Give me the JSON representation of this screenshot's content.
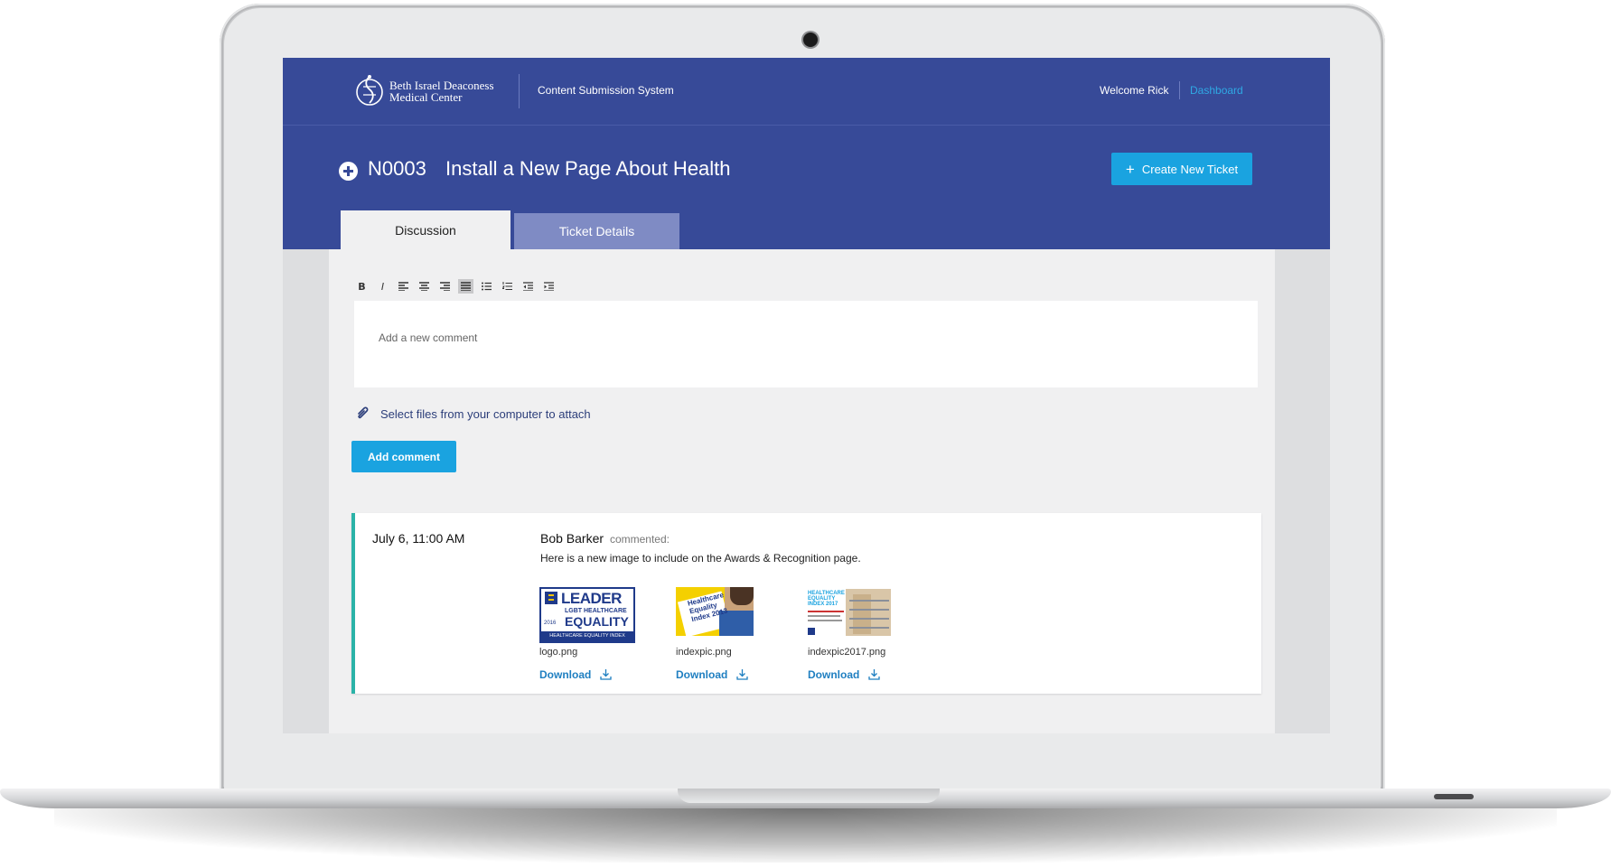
{
  "brand": {
    "org_line1": "Beth Israel Deaconess",
    "org_line2": "Medical Center",
    "system_name": "Content Submission System"
  },
  "nav": {
    "welcome": "Welcome Rick",
    "dashboard": "Dashboard"
  },
  "ticket": {
    "id": "N0003",
    "title": "Install a New Page About Health",
    "create_button": "Create New Ticket"
  },
  "tabs": [
    {
      "label": "Discussion",
      "active": true
    },
    {
      "label": "Ticket Details",
      "active": false
    }
  ],
  "editor": {
    "toolbar": [
      "B",
      "I",
      "align-left",
      "align-center",
      "align-right",
      "justify",
      "bullet-list",
      "numbered-list",
      "outdent",
      "indent"
    ],
    "placeholder": "Add a new comment",
    "attach_text": "Select files from your computer to attach",
    "submit_label": "Add comment"
  },
  "comments": [
    {
      "date": "July 6, 11:00 AM",
      "author": "Bob Barker",
      "verb": "commented:",
      "text": "Here is a new image to include on the Awards & Recognition page.",
      "attachments": [
        {
          "file": "logo.png",
          "download": "Download",
          "thumb_text": [
            "LEADER",
            "LGBT HEALTHCARE",
            "EQUALITY",
            "2016",
            "HEALTHCARE EQUALITY INDEX"
          ]
        },
        {
          "file": "indexpic.png",
          "download": "Download",
          "thumb_text": [
            "Healthcare",
            "Equality",
            "Index 2013"
          ]
        },
        {
          "file": "indexpic2017.png",
          "download": "Download",
          "thumb_text": [
            "HEALTHCARE",
            "EQUALITY",
            "INDEX 2017"
          ]
        }
      ]
    }
  ],
  "colors": {
    "brand_blue": "#374a98",
    "accent_blue": "#1aa3e0",
    "teal_accent": "#2bb3a8"
  }
}
